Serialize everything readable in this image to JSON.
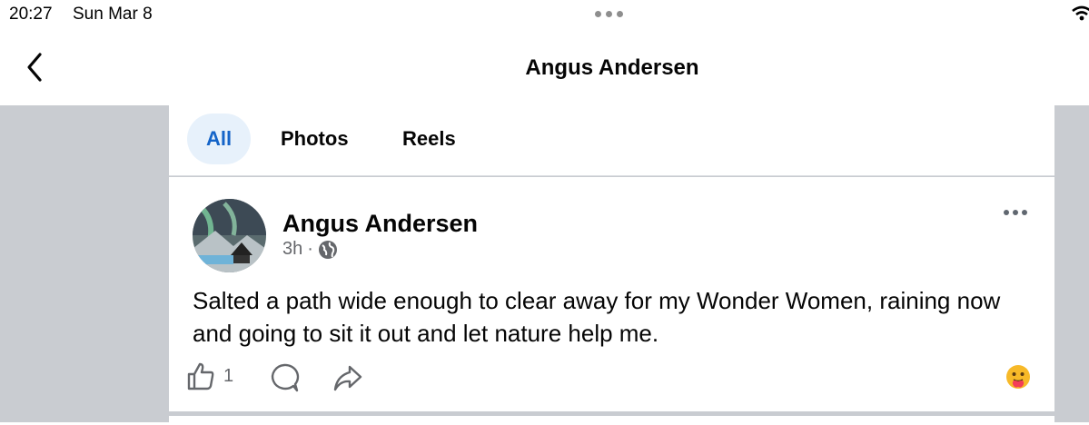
{
  "status_bar": {
    "time": "20:27",
    "date": "Sun Mar 8"
  },
  "nav": {
    "title": "Angus Andersen"
  },
  "filters": [
    {
      "label": "All",
      "selected": true
    },
    {
      "label": "Photos",
      "selected": false
    },
    {
      "label": "Reels",
      "selected": false
    }
  ],
  "post": {
    "author": "Angus Andersen",
    "time": "3h",
    "separator": "·",
    "audience_icon": "globe-icon",
    "text": "Salted a path wide enough to clear away for my Wonder Women, raining now and going to sit it out and let nature help me.",
    "likes": "1",
    "reaction_icon": "care-emoji-icon"
  },
  "colors": {
    "accent": "#1464c8",
    "chip_bg": "#e7f1fb",
    "page_bg": "#c9ccd1",
    "secondary_text": "#65676b"
  }
}
